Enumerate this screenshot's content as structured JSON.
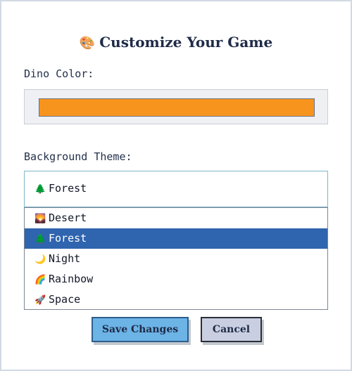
{
  "dialog": {
    "title_icon": "🎨",
    "title": "Customize Your Game"
  },
  "dino_color": {
    "label": "Dino Color:",
    "value_color": "#f7941d"
  },
  "background_theme": {
    "label": "Background Theme:",
    "selected": {
      "icon": "🌲",
      "label": "Forest"
    },
    "options": [
      {
        "icon": "🌄",
        "label": "Desert",
        "selected": false
      },
      {
        "icon": "🌲",
        "label": "Forest",
        "selected": true
      },
      {
        "icon": "🌙",
        "label": "Night",
        "selected": false
      },
      {
        "icon": "🌈",
        "label": "Rainbow",
        "selected": false
      },
      {
        "icon": "🚀",
        "label": "Space",
        "selected": false
      }
    ]
  },
  "buttons": {
    "save_label": "Save Changes",
    "cancel_label": "Cancel"
  },
  "colors": {
    "accent_selected": "#2f64ae",
    "save_button": "#6cb3e6",
    "cancel_button": "#c9cfe0"
  }
}
